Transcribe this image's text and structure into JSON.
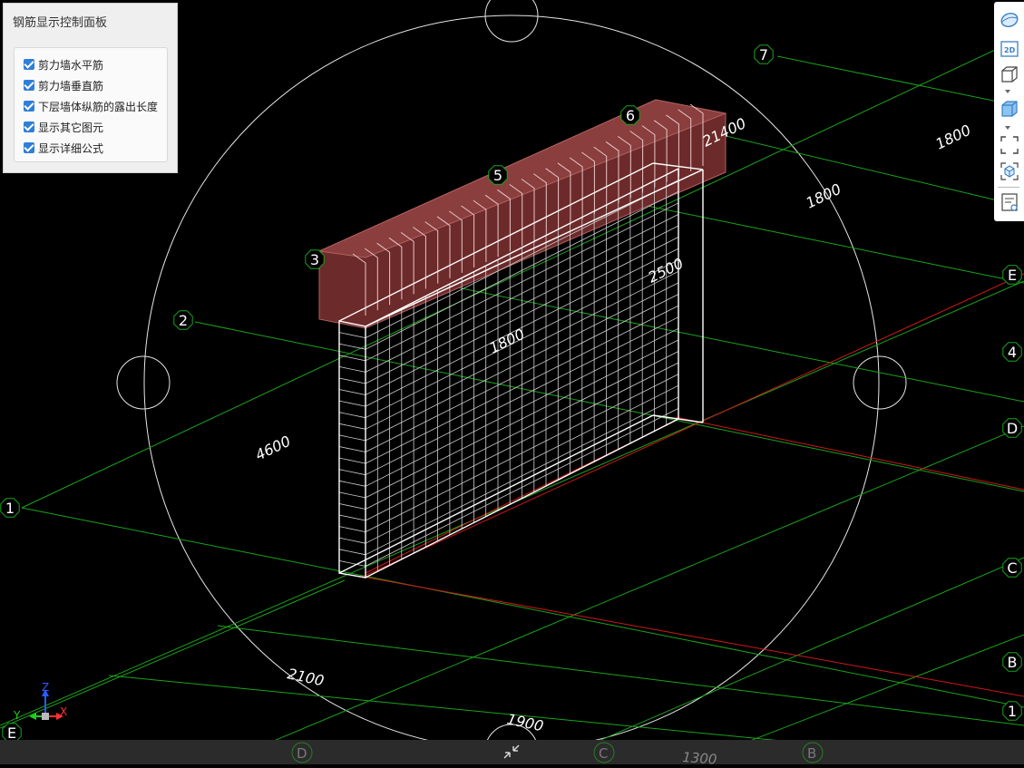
{
  "panel": {
    "title": "钢筋显示控制面板",
    "options": [
      {
        "label": "剪力墙水平筋",
        "checked": true
      },
      {
        "label": "剪力墙垂直筋",
        "checked": true
      },
      {
        "label": "下层墙体纵筋的露出长度",
        "checked": true
      },
      {
        "label": "显示其它图元",
        "checked": true
      },
      {
        "label": "显示详细公式",
        "checked": true
      }
    ]
  },
  "toolbar": {
    "items": [
      {
        "icon": "ellipse-view-icon"
      },
      {
        "icon": "2d-view-icon",
        "label": "2D"
      },
      {
        "icon": "3d-box-icon"
      },
      {
        "icon": "3d-box-filled-icon"
      },
      {
        "icon": "fit-frame-icon"
      },
      {
        "icon": "cube-view-icon"
      },
      {
        "icon": "properties-list-icon"
      }
    ]
  },
  "scene": {
    "axis_bubbles": [
      {
        "label": "1"
      },
      {
        "label": "2"
      },
      {
        "label": "3"
      },
      {
        "label": "5"
      },
      {
        "label": "6"
      },
      {
        "label": "7"
      },
      {
        "label": "E"
      },
      {
        "label": "4"
      },
      {
        "label": "D"
      },
      {
        "label": "C"
      },
      {
        "label": "B"
      },
      {
        "label": "1"
      },
      {
        "label": "E"
      }
    ],
    "dimensions": [
      {
        "value": "21400"
      },
      {
        "value": "1800"
      },
      {
        "value": "1800"
      },
      {
        "value": "2500"
      },
      {
        "value": "1800"
      },
      {
        "value": "4600"
      },
      {
        "value": "2100"
      },
      {
        "value": "1900"
      },
      {
        "value": "1300"
      }
    ],
    "bottom_labels": [
      {
        "label": "D"
      },
      {
        "label": "C"
      },
      {
        "label": "B"
      }
    ]
  },
  "triad": {
    "x": "X",
    "y": "Y",
    "z": "Z"
  },
  "colors": {
    "grid_green": "#1aa31a",
    "grid_red": "#d01818",
    "wall_outline": "#ffffff",
    "beam_fill": "#7a3030",
    "checkbox": "#2f7fd8"
  }
}
